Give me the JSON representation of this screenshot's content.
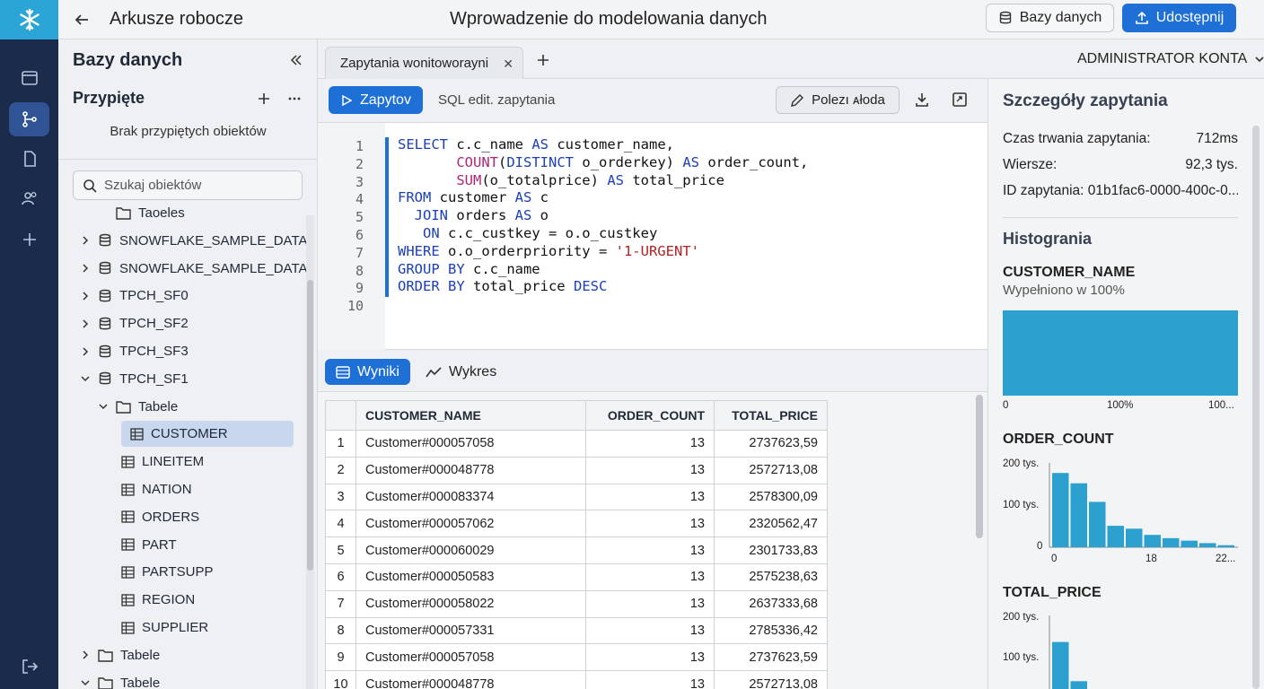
{
  "header": {
    "app_title": "Arkusze robocze",
    "doc_title": "Wprowadzenie do modelowania danych",
    "db_button": "Bazy danych",
    "share_button": "Udostępnij"
  },
  "sidebar": {
    "title": "Bazy danych",
    "pinned_title": "Przypięte",
    "pinned_empty": "Brak przypiętych obiektów",
    "search_placeholder": "Szukaj obiektów",
    "tree": [
      {
        "label": "Taoeles",
        "icon": "folder-icon",
        "chevron": "none",
        "level": 1
      },
      {
        "label": "SNOWFLAKE_SAMPLE_DATA",
        "icon": "database-icon",
        "chevron": "right",
        "level": 0
      },
      {
        "label": "SNOWFLAKE_SAMPLE_DATA",
        "icon": "database-icon",
        "chevron": "right",
        "level": 0
      },
      {
        "label": "TPCH_SF0",
        "icon": "database-icon",
        "chevron": "right",
        "level": 0
      },
      {
        "label": "TPCH_SF2",
        "icon": "database-icon",
        "chevron": "right",
        "level": 0
      },
      {
        "label": "TPCH_SF3",
        "icon": "database-icon",
        "chevron": "right",
        "level": 0
      },
      {
        "label": "TPCH_SF1",
        "icon": "database-icon",
        "chevron": "down",
        "level": 0
      },
      {
        "label": "Tabele",
        "icon": "folder-icon",
        "chevron": "down",
        "level": 1
      },
      {
        "label": "CUSTOMER",
        "icon": "table-icon",
        "chevron": "none",
        "level": 2,
        "selected": true
      },
      {
        "label": "LINEITEM",
        "icon": "table-icon",
        "chevron": "none",
        "level": 2
      },
      {
        "label": "NATION",
        "icon": "table-icon",
        "chevron": "none",
        "level": 2
      },
      {
        "label": "ORDERS",
        "icon": "table-icon",
        "chevron": "none",
        "level": 2
      },
      {
        "label": "PART",
        "icon": "table-icon",
        "chevron": "none",
        "level": 2
      },
      {
        "label": "PARTSUPP",
        "icon": "table-icon",
        "chevron": "none",
        "level": 2
      },
      {
        "label": "REGION",
        "icon": "table-icon",
        "chevron": "none",
        "level": 2
      },
      {
        "label": "SUPPLIER",
        "icon": "table-icon",
        "chevron": "none",
        "level": 2
      },
      {
        "label": "Tabele",
        "icon": "folder-icon",
        "chevron": "right",
        "level": 0
      },
      {
        "label": "Tabele",
        "icon": "folder-icon",
        "chevron": "down",
        "level": 0
      }
    ]
  },
  "tabs": {
    "active_tab": "Zapytania wonitoworayni",
    "role_label": "ADMINISTRATOR KONTA"
  },
  "toolbar": {
    "run_button": "Zapytov",
    "editor_label": "SQL edit. zapytania",
    "help_button": "Polezı ᴀłoda"
  },
  "editor": {
    "line_numbers": [
      "1",
      "2",
      "3",
      "4",
      "5",
      "6",
      "7",
      "8",
      "9",
      "10"
    ]
  },
  "results": {
    "tab_results": "Wyniki",
    "tab_chart": "Wykres",
    "columns": [
      "CUSTOMER_NAME",
      "ORDER_COUNT",
      "TOTAL_PRICE"
    ],
    "rows": [
      [
        "1",
        "Customer#000057058",
        "13",
        "2737623,59"
      ],
      [
        "2",
        "Customer#000048778",
        "13",
        "2572713,08"
      ],
      [
        "3",
        "Customer#000083374",
        "13",
        "2578300,09"
      ],
      [
        "4",
        "Customer#000057062",
        "13",
        "2320562,47"
      ],
      [
        "5",
        "Customer#000060029",
        "13",
        "2301733,83"
      ],
      [
        "6",
        "Customer#000050583",
        "13",
        "2575238,63"
      ],
      [
        "7",
        "Customer#000058022",
        "13",
        "2637333,68"
      ],
      [
        "8",
        "Customer#000057331",
        "13",
        "2785336,42"
      ],
      [
        "9",
        "Customer#000057058",
        "13",
        "2737623,59"
      ],
      [
        "10",
        "Customer#000048778",
        "13",
        "2572713,08"
      ]
    ]
  },
  "details": {
    "title": "Szczegóły zapytania",
    "duration_label": "Czas trwania zapytania:",
    "duration_value": "712ms",
    "rows_label": "Wiersze:",
    "rows_value": "92,3 tys.",
    "id_label": "ID zapytania: 01b1fac6-0000-400c-0...",
    "histograms_title": "Histogrania",
    "hist1": {
      "column": "CUSTOMER_NAME",
      "subtitle": "Wypełniono w 100%",
      "x0": "0",
      "x1": "100%",
      "x2": "100...",
      "fill": 1.0
    },
    "hist2": {
      "column": "ORDER_COUNT",
      "y_top": "200 tys.",
      "y_mid": "100 tys.",
      "y_zero": "0",
      "x0": "0",
      "x1": "18",
      "x2": "22...",
      "bars": [
        180,
        155,
        110,
        52,
        45,
        30,
        22,
        16,
        10,
        5
      ]
    },
    "hist3": {
      "column": "TOTAL_PRICE",
      "y_top": "200 tys.",
      "y_mid": "100 tys.",
      "bars": [
        140,
        45,
        25
      ]
    }
  },
  "colors": {
    "accent": "#1e6fd6",
    "rail": "#1b2b4b",
    "logo_bg": "#2aa5d6",
    "histogram": "#2ca1cf"
  }
}
